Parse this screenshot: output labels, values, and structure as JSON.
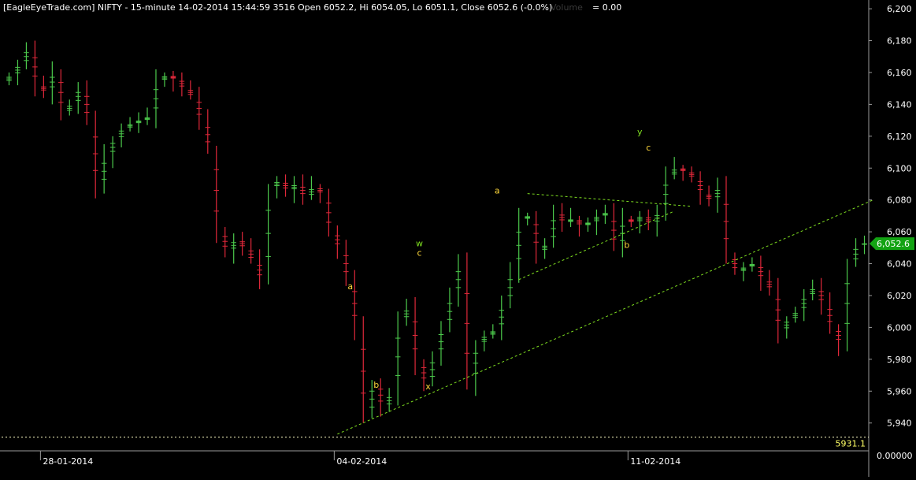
{
  "header": {
    "info": "[EagleEyeTrade.com] NIFTY - 15-minute 14-02-2014 15:44:59 3516 Open 6052.2, Hi 6054.05, Lo 6051.1, Close 6052.6 (-0.0%)",
    "volume_label": "Volume",
    "volume_eq": "= 0.00"
  },
  "colors": {
    "background": "#000000",
    "up": "#4cc94c",
    "down": "#e0283a",
    "trendline": "#7fe020",
    "wave_label": "#ffd83a",
    "wave_label_green": "#7fe020",
    "price_tag": "#13a313",
    "support_line": "#ffffc8"
  },
  "chart_data": {
    "type": "candlestick",
    "symbol": "NIFTY",
    "interval": "15-minute",
    "ohlc_last": {
      "open": 6052.2,
      "high": 6054.05,
      "low": 6051.1,
      "close": 6052.6,
      "change_pct": "-0.0%"
    },
    "y_axis": {
      "min": 5925,
      "max": 6210,
      "ticks": [
        6200,
        6180,
        6160,
        6140,
        6120,
        6100,
        6080,
        6060,
        6040,
        6020,
        6000,
        5980,
        5960,
        5940
      ],
      "tick_labels": [
        "6,200",
        "6,180",
        "6,160",
        "6,140",
        "6,120",
        "6,100",
        "6,080",
        "6,060",
        "6,040",
        "6,020",
        "6,000",
        "5,980",
        "5,960",
        "5,940"
      ],
      "position": "right"
    },
    "x_axis": {
      "bars": 100,
      "date_labels": [
        {
          "text": "28-01-2014",
          "bar": 4
        },
        {
          "text": "04-02-2014",
          "bar": 38
        },
        {
          "text": "11-02-2014",
          "bar": 72
        }
      ]
    },
    "current_price_label": "6,052.6",
    "volume_axis_label": "0.00000",
    "support": {
      "value": 5931.1,
      "label": "5931.1"
    },
    "closes": [
      6158,
      6165,
      6175,
      6152,
      6148,
      6160,
      6135,
      6140,
      6150,
      6130,
      6088,
      6108,
      6118,
      6125,
      6128,
      6130,
      6132,
      6155,
      6158,
      6156,
      6150,
      6145,
      6130,
      6112,
      6060,
      6048,
      6055,
      6050,
      6042,
      6030,
      6088,
      6092,
      6086,
      6090,
      6082,
      6088,
      6084,
      6060,
      6050,
      6030,
      6000,
      5945,
      5965,
      5950,
      5958,
      6005,
      6012,
      5978,
      5965,
      5982,
      6000,
      6020,
      6040,
      5965,
      5990,
      5995,
      5998,
      6015,
      6035,
      6068,
      6070,
      6048,
      6052,
      6072,
      6066,
      6068,
      6064,
      6066,
      6070,
      6072,
      6050,
      6068,
      6066,
      6070,
      6065,
      6072,
      6095,
      6100,
      6098,
      6094,
      6084,
      6080,
      6088,
      6045,
      6035,
      6038,
      6040,
      6030,
      6024,
      5998,
      6005,
      6010,
      6020,
      6025,
      6015,
      6000,
      5990,
      6040,
      6052,
      6052.6
    ],
    "trendlines": [
      {
        "name": "rising-support",
        "from": {
          "bar": 38,
          "price": 5933
        },
        "to": {
          "bar": 100,
          "price": 6080
        }
      },
      {
        "name": "triangle-upper",
        "from": {
          "bar": 60,
          "price": 6084
        },
        "to": {
          "bar": 79,
          "price": 6076
        }
      },
      {
        "name": "triangle-lower",
        "from": {
          "bar": 59,
          "price": 6030
        },
        "to": {
          "bar": 77,
          "price": 6073
        }
      }
    ],
    "annotations": [
      {
        "text": "a",
        "bar": 39.5,
        "price": 6024,
        "color": "yellow"
      },
      {
        "text": "b",
        "bar": 42.5,
        "price": 5962,
        "color": "yellow"
      },
      {
        "text": "w",
        "bar": 47.5,
        "price": 6051,
        "color": "green"
      },
      {
        "text": "c",
        "bar": 47.5,
        "price": 6045,
        "color": "yellow"
      },
      {
        "text": "x",
        "bar": 48.5,
        "price": 5961,
        "color": "yellow"
      },
      {
        "text": "a",
        "bar": 56.5,
        "price": 6084,
        "color": "yellow"
      },
      {
        "text": "b",
        "bar": 71.5,
        "price": 6050,
        "color": "yellow"
      },
      {
        "text": "y",
        "bar": 73,
        "price": 6121,
        "color": "green"
      },
      {
        "text": "c",
        "bar": 74,
        "price": 6111,
        "color": "yellow"
      }
    ]
  }
}
